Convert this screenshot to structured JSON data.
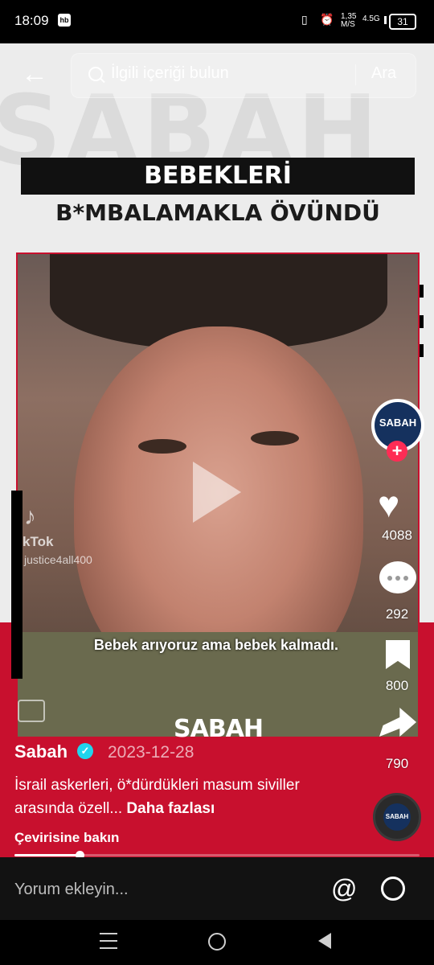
{
  "status": {
    "time": "18:09",
    "app_badge": "hb",
    "net_speed": "1,35 M/S",
    "network": "4.5G",
    "battery": "31"
  },
  "search": {
    "placeholder": "İlgili içeriği bulun",
    "button": "Ara"
  },
  "video": {
    "headline_line1": "BEBEKLERİ",
    "headline_line2": "B*MBALAMAKLA ÖVÜNDÜ",
    "subtitle": "Bebek arıyoruz ama bebek kalmadı.",
    "watermark_tiktok": "kTok",
    "watermark_id": "justice4all400",
    "brand_logo": "SABAH"
  },
  "actions": {
    "avatar_label": "SABAH",
    "likes": "4088",
    "comments": "292",
    "bookmarks": "800",
    "shares": "790"
  },
  "post": {
    "author": "Sabah",
    "date": "2023-12-28",
    "description": "İsrail askerleri, ö*dürdükleri masum siviller arasında özell...",
    "more": "Daha fazlası",
    "translate": "Çevirisine bakın",
    "progress": 0.16
  },
  "comment_bar": {
    "placeholder": "Yorum ekleyin..."
  },
  "colors": {
    "brand_red": "#c8102e",
    "tiktok_pink": "#fe2c55",
    "verified": "#20d5ec"
  },
  "icons": [
    "back-arrow-icon",
    "search-icon",
    "play-icon",
    "heart-icon",
    "comment-icon",
    "bookmark-icon",
    "share-icon",
    "at-icon",
    "emoji-icon",
    "caption-icon"
  ]
}
